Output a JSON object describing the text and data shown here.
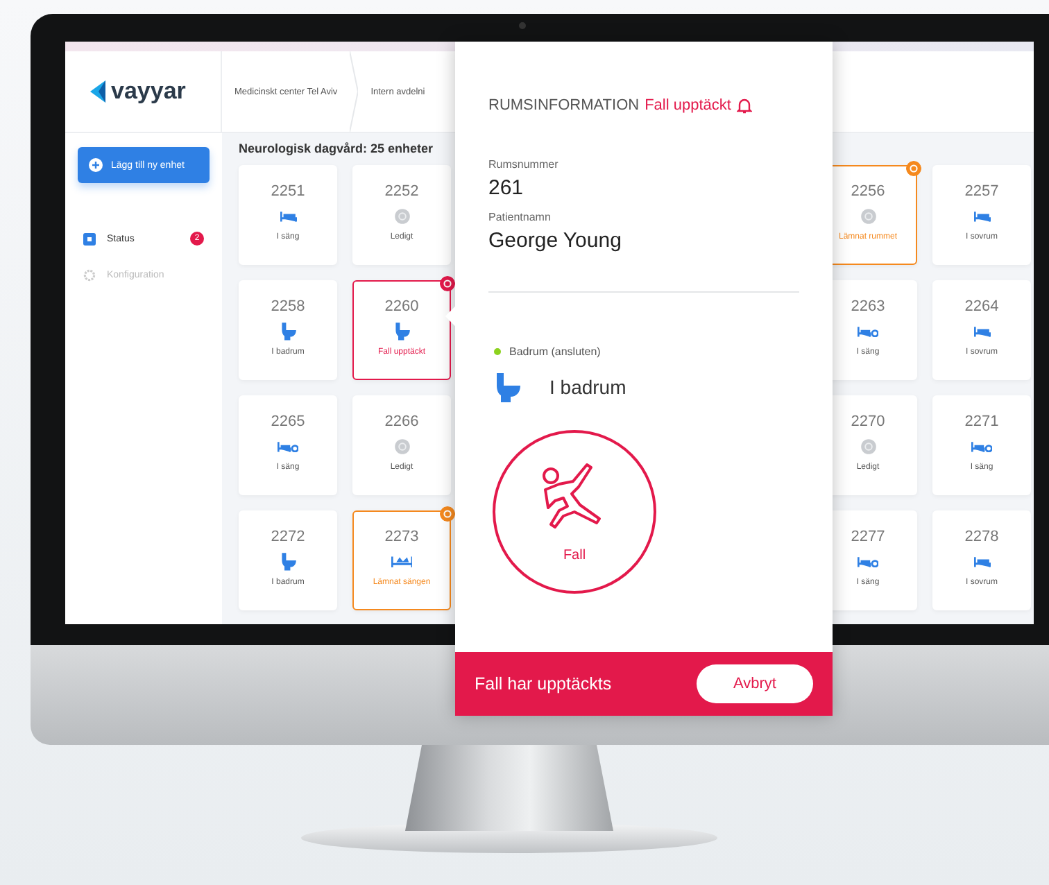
{
  "logo": "vayyar",
  "breadcrumbs": [
    "Medicinskt center Tel Aviv",
    "Intern avdelni"
  ],
  "sidebar": {
    "add_button": "Lägg till ny enhet",
    "items": [
      {
        "label": "Status",
        "kind": "status",
        "selected": true,
        "badge": "2"
      },
      {
        "label": "Konfiguration",
        "kind": "settings",
        "selected": false
      }
    ]
  },
  "ward_title": "Neurologisk dagvård: 25 enheter",
  "cards_left": [
    {
      "number": "2251",
      "kind": "bed",
      "status": "I säng"
    },
    {
      "number": "2252",
      "kind": "vacant",
      "status": "Ledigt"
    },
    {
      "number": "2258",
      "kind": "bathroom",
      "status": "I badrum"
    },
    {
      "number": "2260",
      "kind": "bathroom",
      "status": "Fall upptäckt",
      "color": "#e3194b"
    },
    {
      "number": "2265",
      "kind": "bed_sensor",
      "status": "I säng"
    },
    {
      "number": "2266",
      "kind": "vacant",
      "status": "Ledigt"
    },
    {
      "number": "2272",
      "kind": "bathroom",
      "status": "I badrum"
    },
    {
      "number": "2273",
      "kind": "left_bed",
      "status": "Lämnat sängen",
      "color": "#f5891e"
    }
  ],
  "cards_right": [
    {
      "number": "2256",
      "kind": "vacant",
      "status": "Lämnat rummet",
      "color": "#f5891e"
    },
    {
      "number": "2257",
      "kind": "bed",
      "status": "I sovrum"
    },
    {
      "number": "2263",
      "kind": "bed_sensor",
      "status": "I säng"
    },
    {
      "number": "2264",
      "kind": "bed",
      "status": "I sovrum"
    },
    {
      "number": "2270",
      "kind": "vacant",
      "status": "Ledigt"
    },
    {
      "number": "2271",
      "kind": "bed_sensor",
      "status": "I säng"
    },
    {
      "number": "2277",
      "kind": "bed_sensor",
      "status": "I säng"
    },
    {
      "number": "2278",
      "kind": "bed",
      "status": "I sovrum"
    }
  ],
  "room_info": {
    "title": "RUMSINFORMATION",
    "alert": "Fall upptäckt",
    "room_label": "Rumsnummer",
    "room_number": "261",
    "patient_label": "Patientnamn",
    "patient_name": "George Young",
    "sensor": {
      "label": "Badrum (ansluten)",
      "connected": true
    },
    "location": {
      "kind": "bathroom",
      "label": "I badrum"
    },
    "event": {
      "kind": "fall",
      "label": "Fall"
    },
    "footer": {
      "message": "Fall har upptäckts",
      "button": "Avbryt"
    }
  }
}
